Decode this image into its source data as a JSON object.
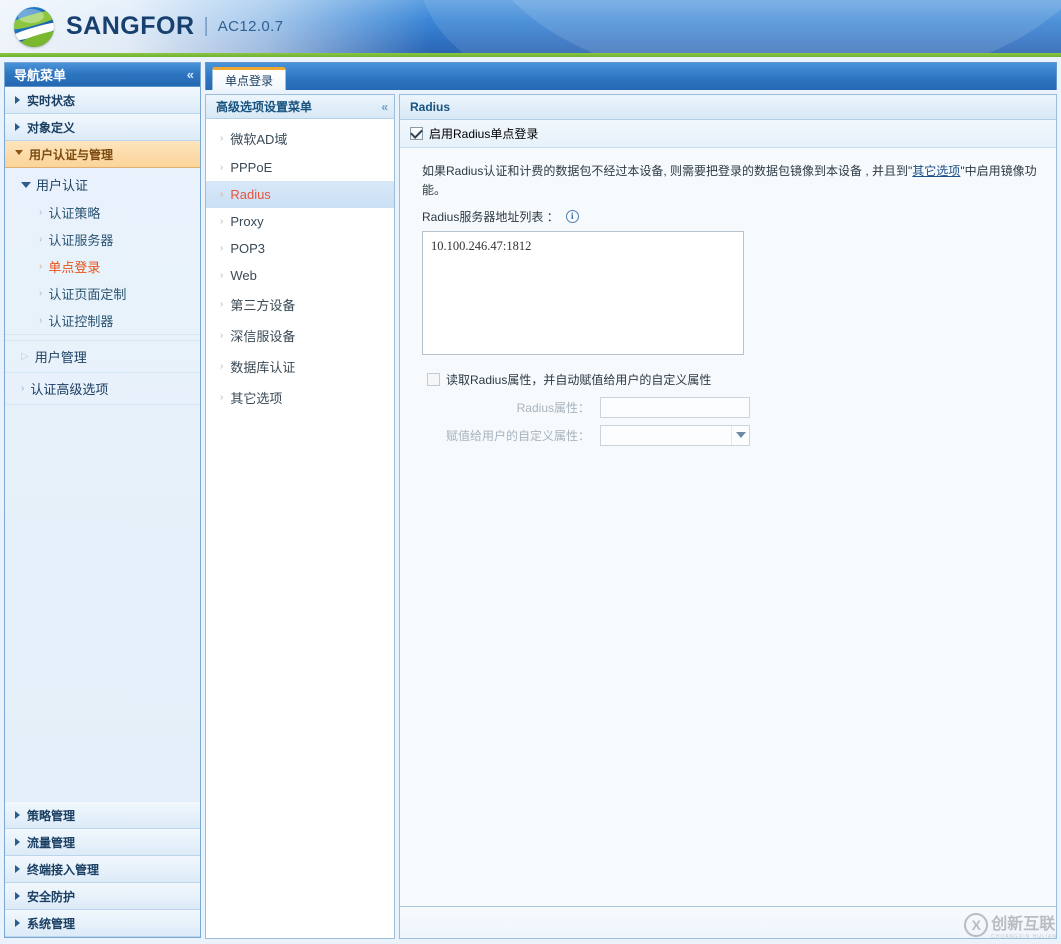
{
  "header": {
    "brand": "SANGFOR",
    "separator": "|",
    "version": "AC12.0.7",
    "logo_icon": "globe-logo-icon"
  },
  "nav_sidebar": {
    "title": "导航菜单",
    "collapse_icon": "«",
    "groups": [
      {
        "label": "实时状态",
        "active": false
      },
      {
        "label": "对象定义",
        "active": false
      },
      {
        "label": "用户认证与管理",
        "active": true
      }
    ],
    "expanded_section": {
      "label": "用户认证",
      "items": [
        {
          "label": "认证策略",
          "selected": false
        },
        {
          "label": "认证服务器",
          "selected": false
        },
        {
          "label": "单点登录",
          "selected": true
        },
        {
          "label": "认证页面定制",
          "selected": false
        },
        {
          "label": "认证控制器",
          "selected": false
        }
      ]
    },
    "sub_sections": [
      {
        "label": "用户管理"
      },
      {
        "label": "认证高级选项"
      }
    ],
    "bottom_groups": [
      {
        "label": "策略管理"
      },
      {
        "label": "流量管理"
      },
      {
        "label": "终端接入管理"
      },
      {
        "label": "安全防护"
      },
      {
        "label": "系统管理"
      }
    ]
  },
  "tabs": [
    {
      "label": "单点登录",
      "active": true
    }
  ],
  "submenu": {
    "title": "高级选项设置菜单",
    "collapse_icon": "«",
    "items": [
      {
        "label": "微软AD域",
        "selected": false
      },
      {
        "label": "PPPoE",
        "selected": false
      },
      {
        "label": "Radius",
        "selected": true
      },
      {
        "label": "Proxy",
        "selected": false
      },
      {
        "label": "POP3",
        "selected": false
      },
      {
        "label": "Web",
        "selected": false
      },
      {
        "label": "第三方设备",
        "selected": false
      },
      {
        "label": "深信服设备",
        "selected": false
      },
      {
        "label": "数据库认证",
        "selected": false
      },
      {
        "label": "其它选项",
        "selected": false
      }
    ]
  },
  "content": {
    "title": "Radius",
    "enable_checkbox": {
      "label": "启用Radius单点登录",
      "checked": true
    },
    "description": {
      "part1": "如果Radius认证和计费的数据包不经过本设备, 则需要把登录的数据包镜像到本设备 , 并且到\"",
      "link": "其它选项",
      "part2": "\"中启用镜像功能。"
    },
    "server_list": {
      "label": "Radius服务器地址列表 ：",
      "info_icon": "i",
      "value": "10.100.246.47:1812"
    },
    "attribute_checkbox": {
      "label": "读取Radius属性，并自动赋值给用户的自定义属性",
      "checked": false
    },
    "fields": [
      {
        "label": "Radius属性：",
        "value": "",
        "type": "text",
        "disabled": true
      },
      {
        "label": "赋值给用户的自定义属性：",
        "value": "",
        "type": "select",
        "disabled": true
      }
    ]
  },
  "watermark": {
    "mark": "X",
    "text": "创新互联",
    "sub": "CHUANGXIN HULIAN"
  },
  "colors": {
    "header_blue": "#2f6fc0",
    "accent_green": "#8cc63f",
    "active_nav": "#fbd49a",
    "selected_text": "#e8533d",
    "tab_top": "#f0a830"
  }
}
